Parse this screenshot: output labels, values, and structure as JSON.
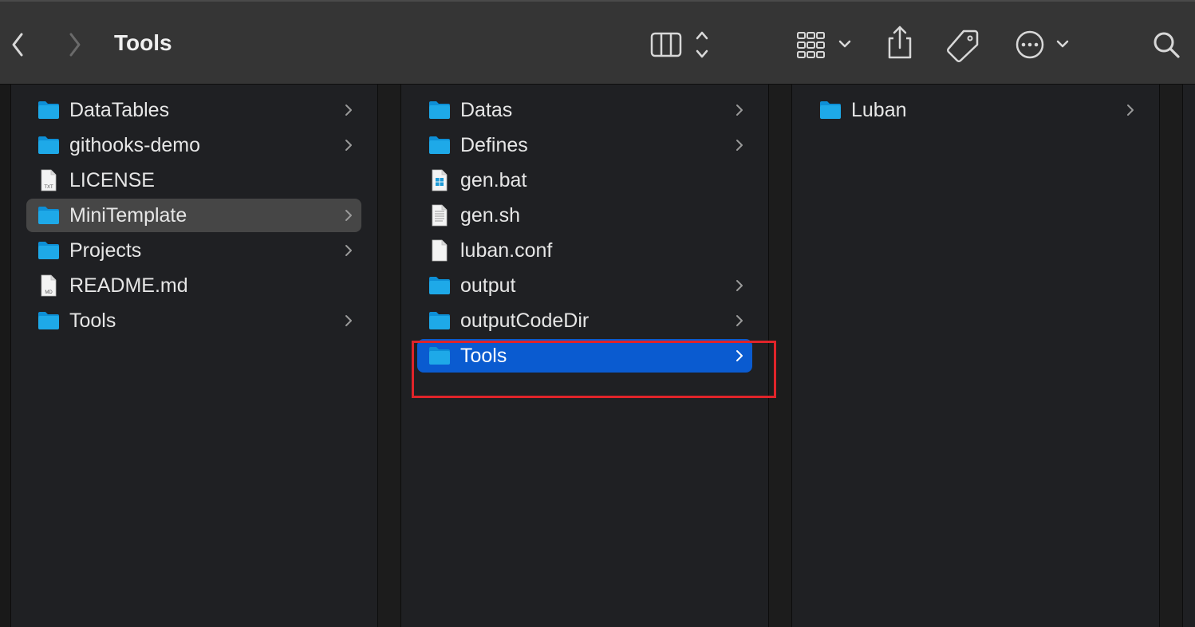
{
  "window": {
    "title": "Tools"
  },
  "toolbar": {
    "back_icon": "chevron-left-icon",
    "forward_icon": "chevron-right-icon",
    "view_icon": "columns-view-icon",
    "group_icon": "grid-group-icon",
    "share_icon": "share-icon",
    "tag_icon": "tag-icon",
    "more_icon": "ellipsis-circle-icon",
    "search_icon": "search-icon"
  },
  "columns": [
    {
      "items": [
        {
          "name": "DataTables",
          "kind": "folder",
          "expandable": true
        },
        {
          "name": "githooks-demo",
          "kind": "folder",
          "expandable": true
        },
        {
          "name": "LICENSE",
          "kind": "txt",
          "badge": "TXT",
          "expandable": false
        },
        {
          "name": "MiniTemplate",
          "kind": "folder",
          "expandable": true,
          "selected": "inactive"
        },
        {
          "name": "Projects",
          "kind": "folder",
          "expandable": true
        },
        {
          "name": "README.md",
          "kind": "md",
          "badge": "MD",
          "expandable": false
        },
        {
          "name": "Tools",
          "kind": "folder",
          "expandable": true
        }
      ]
    },
    {
      "items": [
        {
          "name": "Datas",
          "kind": "folder",
          "expandable": true
        },
        {
          "name": "Defines",
          "kind": "folder",
          "expandable": true
        },
        {
          "name": "gen.bat",
          "kind": "bat",
          "expandable": false
        },
        {
          "name": "gen.sh",
          "kind": "sh",
          "expandable": false
        },
        {
          "name": "luban.conf",
          "kind": "blank",
          "expandable": false
        },
        {
          "name": "output",
          "kind": "folder",
          "expandable": true
        },
        {
          "name": "outputCodeDir",
          "kind": "folder",
          "expandable": true
        },
        {
          "name": "Tools",
          "kind": "folder",
          "expandable": true,
          "selected": "active"
        }
      ]
    },
    {
      "items": [
        {
          "name": "Luban",
          "kind": "folder",
          "expandable": true
        }
      ]
    }
  ],
  "colors": {
    "folder": "#1ea9e8",
    "selection_active": "#0a5bd0",
    "selection_inactive": "#464646",
    "annotation": "#e0242a"
  }
}
